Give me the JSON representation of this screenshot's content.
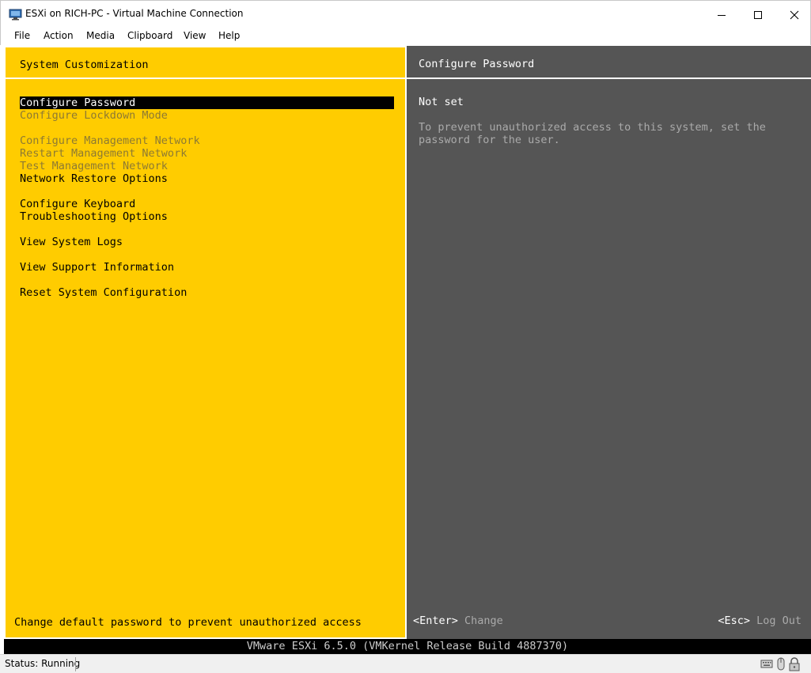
{
  "window": {
    "title": "ESXi on RICH-PC - Virtual Machine Connection",
    "app_icon": "monitor-icon",
    "controls": [
      "minimize-icon",
      "maximize-icon",
      "close-icon"
    ]
  },
  "menubar": {
    "items": [
      "File",
      "Action",
      "Media",
      "Clipboard",
      "View",
      "Help"
    ]
  },
  "dcui": {
    "left_title": "System Customization",
    "menu": [
      {
        "label": "Configure Password",
        "state": "selected"
      },
      {
        "label": "Configure Lockdown Mode",
        "state": "disabled"
      },
      {
        "label": "Configure Management Network",
        "state": "disabled"
      },
      {
        "label": "Restart Management Network",
        "state": "disabled"
      },
      {
        "label": "Test Management Network",
        "state": "disabled"
      },
      {
        "label": "Network Restore Options",
        "state": "active"
      },
      {
        "label": "Configure Keyboard",
        "state": "active"
      },
      {
        "label": "Troubleshooting Options",
        "state": "active"
      },
      {
        "label": "View System Logs",
        "state": "active"
      },
      {
        "label": "View Support Information",
        "state": "active"
      },
      {
        "label": "Reset System Configuration",
        "state": "active"
      }
    ],
    "right_title": "Configure Password",
    "status_value": "Not set",
    "help_text": "To prevent unauthorized access to this system, set the\npassword for the user.",
    "left_footer": "Change default password to prevent unauthorized access",
    "enter_key": "<Enter>",
    "enter_action": "Change",
    "esc_key": "<Esc>",
    "esc_action": "Log Out",
    "build": "VMware ESXi 6.5.0 (VMKernel Release Build 4887370)",
    "colors": {
      "panel_left": "#ffcc00",
      "panel_right": "#555555",
      "disabled_text": "#8d7a33"
    }
  },
  "statusbar": {
    "status": "Status: Running",
    "tray_icons": [
      "keyboard-icon",
      "mouse-icon",
      "lock-icon"
    ]
  }
}
